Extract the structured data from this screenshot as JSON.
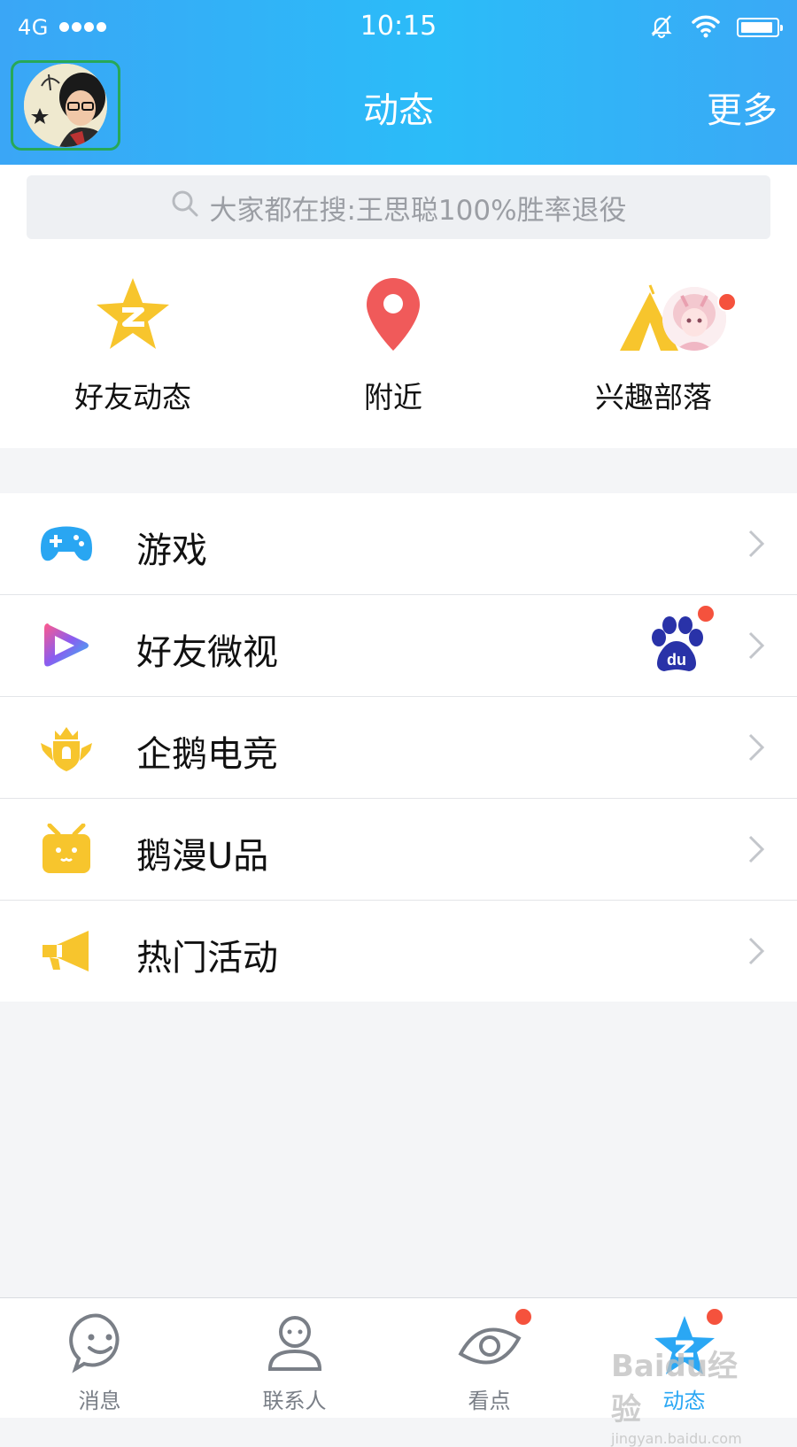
{
  "status_bar": {
    "signal": "4G",
    "time": "10:15"
  },
  "header": {
    "title": "动态",
    "more_label": "更多"
  },
  "search": {
    "placeholder": "大家都在搜:王思聪100%胜率退役"
  },
  "quick_entries": [
    {
      "label": "好友动态",
      "icon": "star-icon",
      "color": "#f7c52d"
    },
    {
      "label": "附近",
      "icon": "location-pin-icon",
      "color": "#f05a5a"
    },
    {
      "label": "兴趣部落",
      "icon": "tent-icon",
      "color": "#f7c52d",
      "badge": true
    }
  ],
  "menu_items": [
    {
      "label": "游戏",
      "icon": "gamepad-icon",
      "color": "#29a6f2"
    },
    {
      "label": "好友微视",
      "icon": "play-icon",
      "color": "#8a5cf0",
      "badge": "baidu-paw-icon"
    },
    {
      "label": "企鹅电竞",
      "icon": "crown-shield-icon",
      "color": "#f7c52d"
    },
    {
      "label": "鹅漫U品",
      "icon": "tv-box-icon",
      "color": "#f7c52d"
    },
    {
      "label": "热门活动",
      "icon": "megaphone-icon",
      "color": "#f7c52d"
    }
  ],
  "tabs": [
    {
      "label": "消息",
      "icon": "smile-chat-icon",
      "active": false
    },
    {
      "label": "联系人",
      "icon": "person-icon",
      "active": false
    },
    {
      "label": "看点",
      "icon": "eye-icon",
      "active": false,
      "badge": true
    },
    {
      "label": "动态",
      "icon": "star-icon",
      "active": true,
      "badge": true
    }
  ],
  "watermark": {
    "brand": "Baidu经验",
    "url": "jingyan.baidu.com"
  },
  "colors": {
    "header_start": "#3aa6f6",
    "header_end": "#2bbcf8",
    "accent": "#2aa7f4",
    "badge_red": "#f5523d"
  }
}
